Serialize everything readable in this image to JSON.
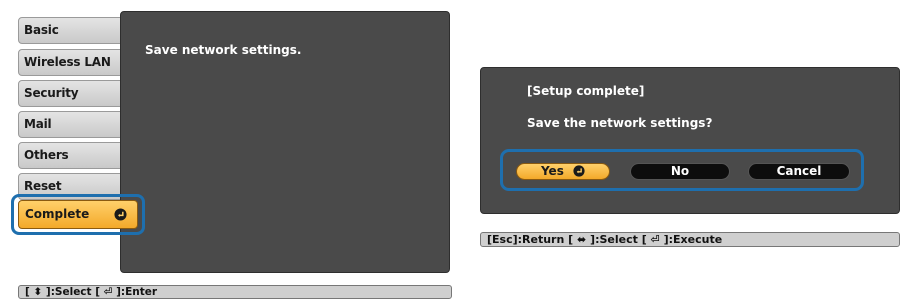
{
  "left_screen": {
    "menu": [
      {
        "label": "Basic"
      },
      {
        "label": "Wireless LAN"
      },
      {
        "label": "Security"
      },
      {
        "label": "Mail"
      },
      {
        "label": "Others"
      },
      {
        "label": "Reset"
      },
      {
        "label": "Complete"
      }
    ],
    "message": "Save network settings.",
    "footer": "[ ⬍ ]:Select  [ ⏎ ]:Enter"
  },
  "right_screen": {
    "title": "[Setup complete]",
    "question": "Save the network settings?",
    "buttons": {
      "yes": "Yes",
      "no": "No",
      "cancel": "Cancel"
    },
    "footer": "[Esc]:Return  [ ⬌ ]:Select  [ ⏎ ]:Execute"
  },
  "colors": {
    "panel": "#4a4a4a",
    "highlight_border": "#1e6fae",
    "selected": "#f3a92a"
  },
  "icons": [
    "enter-icon"
  ]
}
